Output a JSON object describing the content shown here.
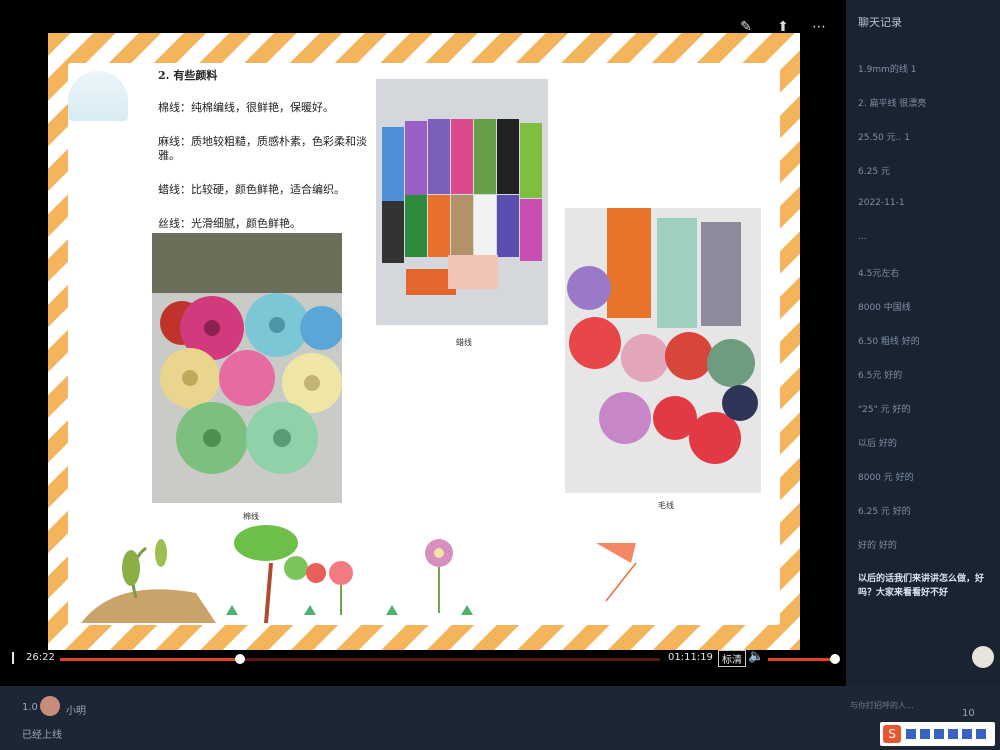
{
  "slide": {
    "heading": "2. 有些颜料",
    "lines": [
      "棉线：纯棉编线，很鲜艳，保暖好。",
      "麻线：质地较粗糙，质感朴素，色彩柔和淡雅。",
      "蜡线：比较硬，颜色鲜艳，适合编织。",
      "丝线：光滑细腻，颜色鲜艳。"
    ],
    "captions": {
      "photo1": "棉线",
      "photo2": "蜡线",
      "photo3": "毛线"
    }
  },
  "player": {
    "current_time": "26:22",
    "total_time": "01:11:19",
    "progress": 0.3,
    "quality_label": "标清",
    "volume": 1.0
  },
  "sidebar": {
    "title": "聊天记录",
    "items": [
      "1.9mm的线 1",
      "2. 扁平线 很漂亮",
      "25.50 元.. 1",
      "6.25 元",
      "2022-11-1",
      "...",
      "4.5元左右",
      "8000 中国线",
      "6.50 粗线 好的",
      "6.5元 好的",
      "\"25\" 元 好的",
      "以后 好的",
      "8000 元 好的",
      "6.25 元 好的",
      "好的 好的"
    ],
    "highlight": "以后的话我们来讲讲怎么做，好吗？大家来看看好不好"
  },
  "bottom": {
    "user_name": "小明",
    "status": "已经上线",
    "stat_label": "1.0",
    "hint_text": "与你打招呼的人...",
    "count_label": "10"
  },
  "colors": {
    "accent": "#e0441f",
    "stripe": "#f3b45c",
    "sidebar_bg": "#1a2431"
  }
}
